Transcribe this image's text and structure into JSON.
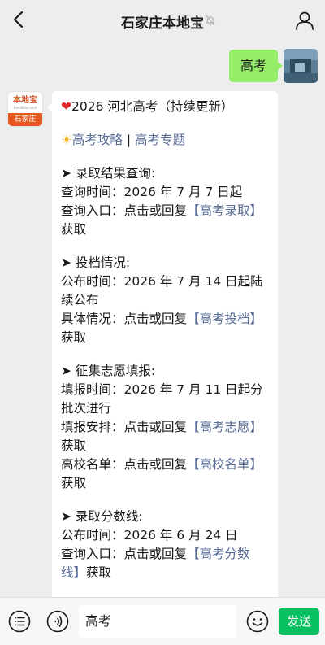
{
  "header": {
    "title": "石家庄本地宝"
  },
  "outgoing": {
    "text": "高考"
  },
  "account": {
    "logo_text": "本地宝",
    "logo_url": "Bendibao.com",
    "band_text": "石家庄"
  },
  "message": {
    "heading": "2026 河北高考（持续更新）",
    "links": {
      "guide": "高考攻略",
      "separator": " | ",
      "topic": "高考专题"
    },
    "sections": [
      {
        "title": "录取结果查询:",
        "line1": "查询时间：2026 年 7 月 7 日起",
        "prefix": "查询入口：点击或回复",
        "keyword": "【高考录取】",
        "suffix": "获取"
      },
      {
        "title": "投档情况:",
        "line1a": "公布时间：2026 年 7 月 14 日起陆",
        "line1b": "续公布",
        "prefix": "具体情况：点击或回复",
        "keyword": "【高考投档】",
        "suffix": "获取"
      },
      {
        "title": "征集志愿填报:",
        "line1a": "填报时间：2026 年 7 月 11 日起分",
        "line1b": "批次进行",
        "prefix": "填报安排：点击或回复",
        "keyword": "【高考志愿】",
        "suffix": "获取",
        "prefix2": "高校名单：点击或回复",
        "keyword2": "【高校名单】",
        "suffix2": "获取"
      },
      {
        "title": "录取分数线:",
        "line1": "公布时间：2026 年 6 月 24 日",
        "prefix": "查询入口：点击或回复",
        "keyword_a": "【高考分数",
        "keyword_b": "线】",
        "suffix": "获取"
      }
    ]
  },
  "input": {
    "value": "高考",
    "send_label": "发送"
  },
  "icons": {
    "back": "chevron-left-icon",
    "mute": "bell-off-icon",
    "profile": "person-icon",
    "menu": "menu-list-icon",
    "voice": "voice-icon",
    "emoji": "emoji-icon"
  },
  "colors": {
    "background": "#ededed",
    "outgoing_bubble": "#95ec69",
    "link": "#576b95",
    "send_button": "#07c160",
    "account_band": "#e4571f"
  }
}
